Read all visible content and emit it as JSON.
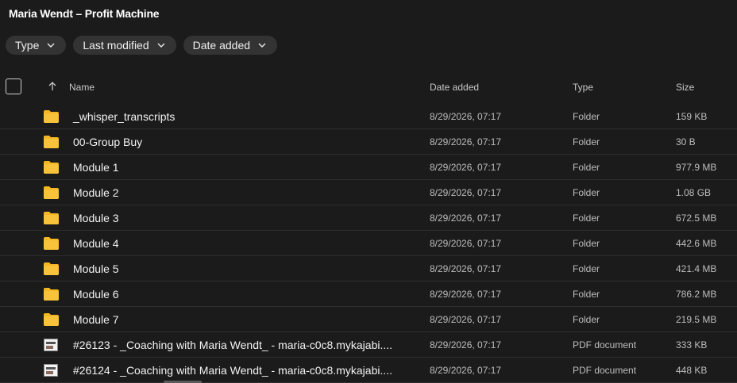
{
  "window": {
    "title": "Maria Wendt – Profit Machine"
  },
  "filters": [
    {
      "label": "Type"
    },
    {
      "label": "Last modified"
    },
    {
      "label": "Date added"
    }
  ],
  "columns": {
    "name": "Name",
    "date_added": "Date added",
    "type": "Type",
    "size": "Size"
  },
  "rows": [
    {
      "name": "_whisper_transcripts",
      "date": "8/29/2026, 07:17",
      "type": "Folder",
      "size": "159 KB",
      "icon": "folder-icon"
    },
    {
      "name": "00-Group Buy",
      "date": "8/29/2026, 07:17",
      "type": "Folder",
      "size": "30 B",
      "icon": "folder-icon"
    },
    {
      "name": "Module 1",
      "date": "8/29/2026, 07:17",
      "type": "Folder",
      "size": "977.9 MB",
      "icon": "folder-icon"
    },
    {
      "name": "Module 2",
      "date": "8/29/2026, 07:17",
      "type": "Folder",
      "size": "1.08 GB",
      "icon": "folder-icon"
    },
    {
      "name": "Module 3",
      "date": "8/29/2026, 07:17",
      "type": "Folder",
      "size": "672.5 MB",
      "icon": "folder-icon"
    },
    {
      "name": "Module 4",
      "date": "8/29/2026, 07:17",
      "type": "Folder",
      "size": "442.6 MB",
      "icon": "folder-icon"
    },
    {
      "name": "Module 5",
      "date": "8/29/2026, 07:17",
      "type": "Folder",
      "size": "421.4 MB",
      "icon": "folder-icon"
    },
    {
      "name": "Module 6",
      "date": "8/29/2026, 07:17",
      "type": "Folder",
      "size": "786.2 MB",
      "icon": "folder-icon"
    },
    {
      "name": "Module 7",
      "date": "8/29/2026, 07:17",
      "type": "Folder",
      "size": "219.5 MB",
      "icon": "folder-icon"
    },
    {
      "name": "#26123 - _Coaching with Maria Wendt_ - maria-c0c8.mykajabi....",
      "date": "8/29/2026, 07:17",
      "type": "PDF document",
      "size": "333 KB",
      "icon": "pdf-thumbnail-icon"
    },
    {
      "name": "#26124 - _Coaching with Maria Wendt_ - maria-c0c8.mykajabi....",
      "date": "8/29/2026, 07:17",
      "type": "PDF document",
      "size": "448 KB",
      "icon": "pdf-thumbnail-icon"
    }
  ],
  "colors": {
    "background": "#1b1b1b",
    "chip": "#333333",
    "folder": "#f5b624"
  }
}
